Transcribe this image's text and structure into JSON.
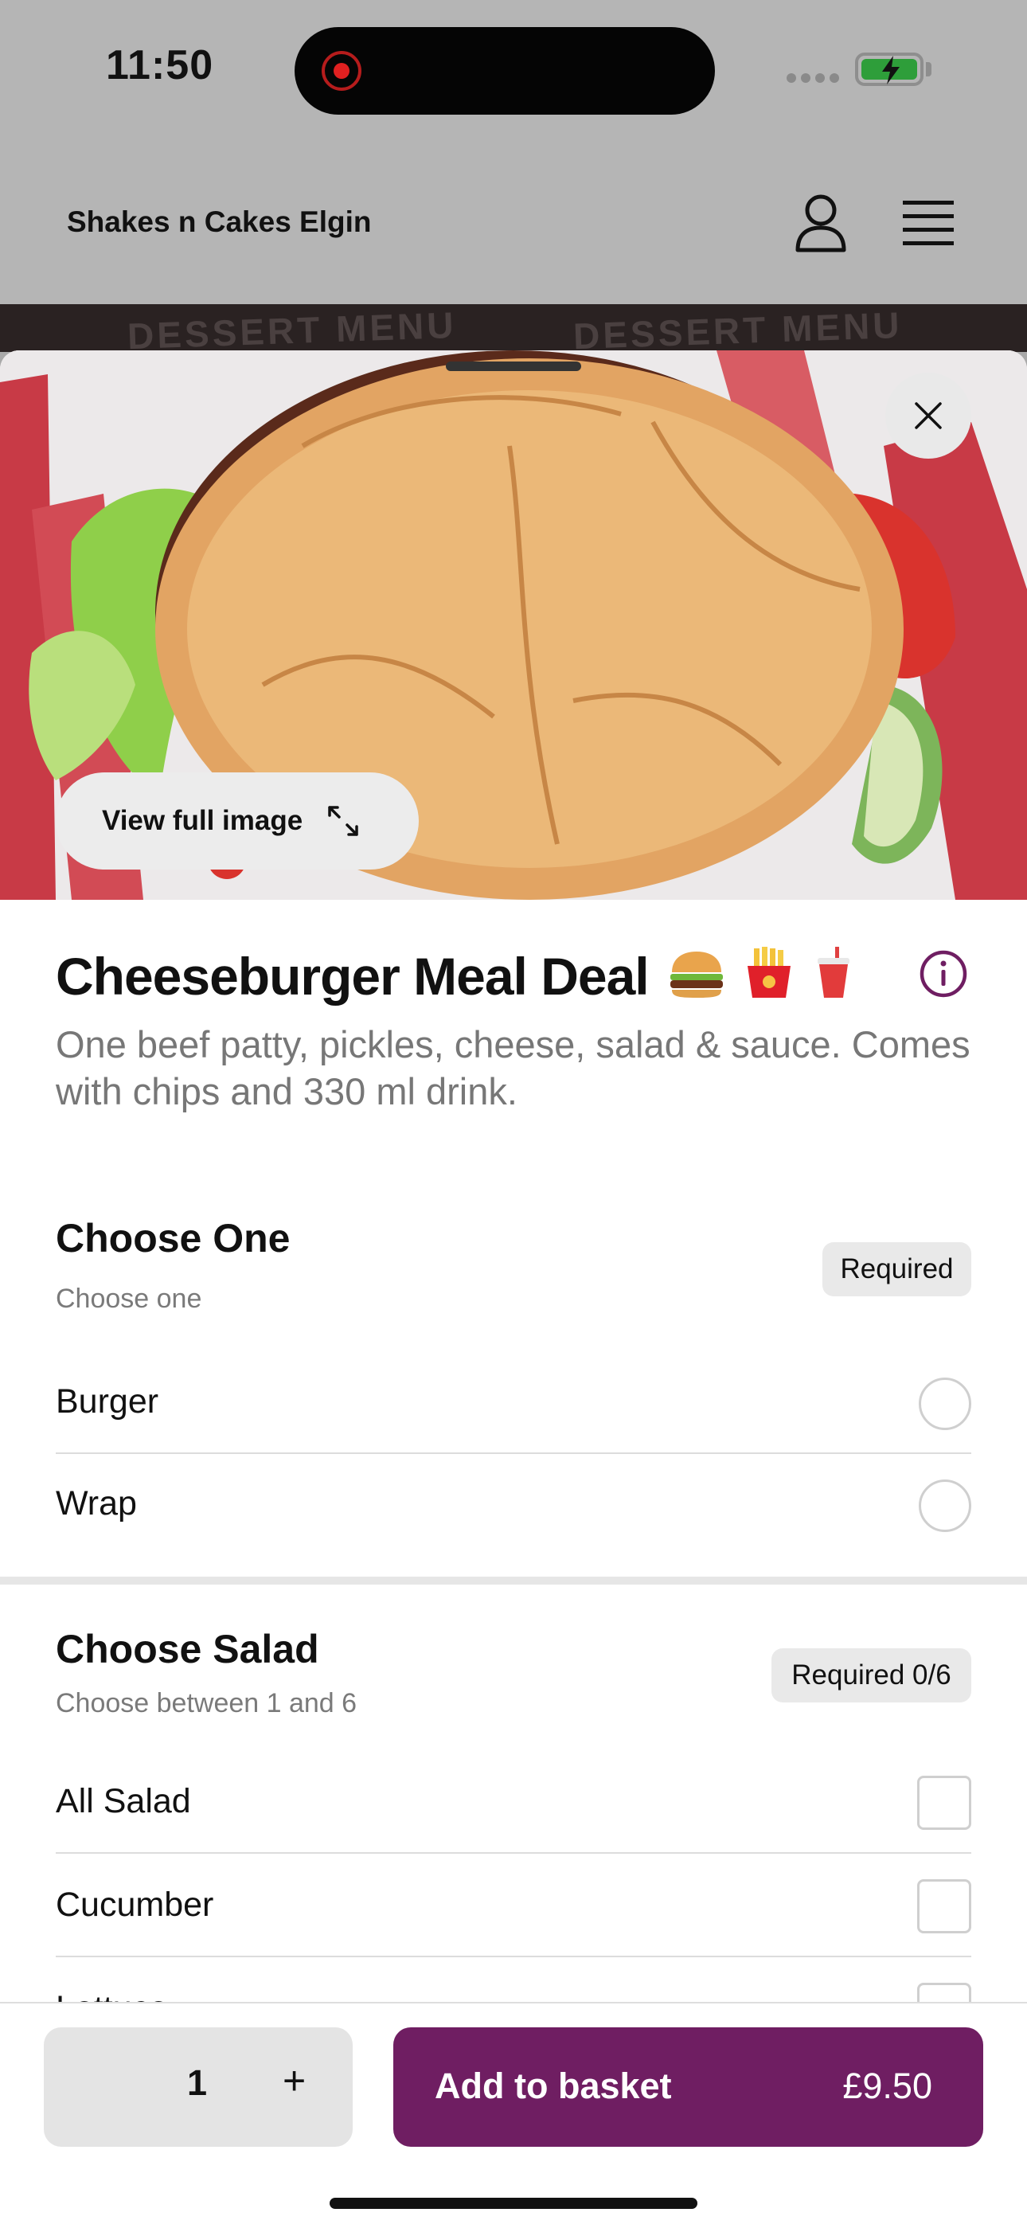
{
  "status_bar": {
    "time": "11:50"
  },
  "site": {
    "title": "Shakes n Cakes Elgin",
    "backdrop_text_1": "DESSERT MENU",
    "backdrop_text_2": "DESSERT MENU"
  },
  "hero": {
    "view_full_label": "View full image"
  },
  "item": {
    "title": "Cheeseburger Meal Deal",
    "description": "One beef patty, pickles, cheese, salad & sauce. Comes with chips and 330 ml drink."
  },
  "groups": [
    {
      "title": "Choose One",
      "subtitle": "Choose one",
      "badge": "Required",
      "options": [
        {
          "label": "Burger"
        },
        {
          "label": "Wrap"
        }
      ]
    },
    {
      "title": "Choose Salad",
      "subtitle": "Choose between 1 and 6",
      "badge": "Required 0/6",
      "options": [
        {
          "label": "All Salad"
        },
        {
          "label": "Cucumber"
        },
        {
          "label": "Lettuce"
        }
      ]
    }
  ],
  "footer": {
    "quantity": "1",
    "plus_label": "+",
    "add_label": "Add to basket",
    "price": "£9.50",
    "accent_color": "#6f1e62"
  }
}
